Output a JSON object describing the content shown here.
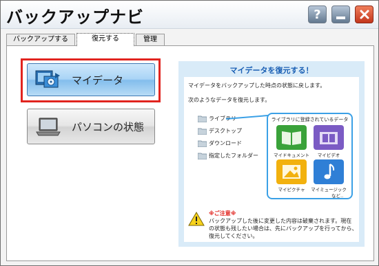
{
  "window": {
    "title": "バックアップナビ",
    "help": "?"
  },
  "tabs": [
    {
      "label": "バックアップする"
    },
    {
      "label": "復元する"
    },
    {
      "label": "管理"
    }
  ],
  "buttons": {
    "mydata": "マイデータ",
    "pc_state": "パソコンの状態"
  },
  "info": {
    "title": "マイデータを復元する！",
    "line1": "マイデータをバックアップした時点の状態に戻します。",
    "line2": "次のようなデータを復元します。",
    "folders": [
      "ライブラリ",
      "デスクトップ",
      "ダウンロード",
      "指定したフォルダー"
    ],
    "library_header": "ライブラリに登録されているデータ",
    "tiles": [
      {
        "label": "マイドキュメント",
        "color": "#3aa23a"
      },
      {
        "label": "マイビデオ",
        "color": "#7b5bc4"
      },
      {
        "label": "マイピクチャ",
        "color": "#f2b10e"
      },
      {
        "label": "マイミュージック",
        "color": "#2f7fd6"
      }
    ],
    "tiles_more": "など..",
    "note_title": "※ご注意※",
    "note_lines": [
      "バックアップした後に変更した内容は破棄されます。現在",
      "の状態も残したい場合は、先にバックアップを行ってから、",
      "復元してください。"
    ]
  },
  "colors": {
    "accent": "#1a5fb4",
    "highlight": "#e1241f"
  }
}
